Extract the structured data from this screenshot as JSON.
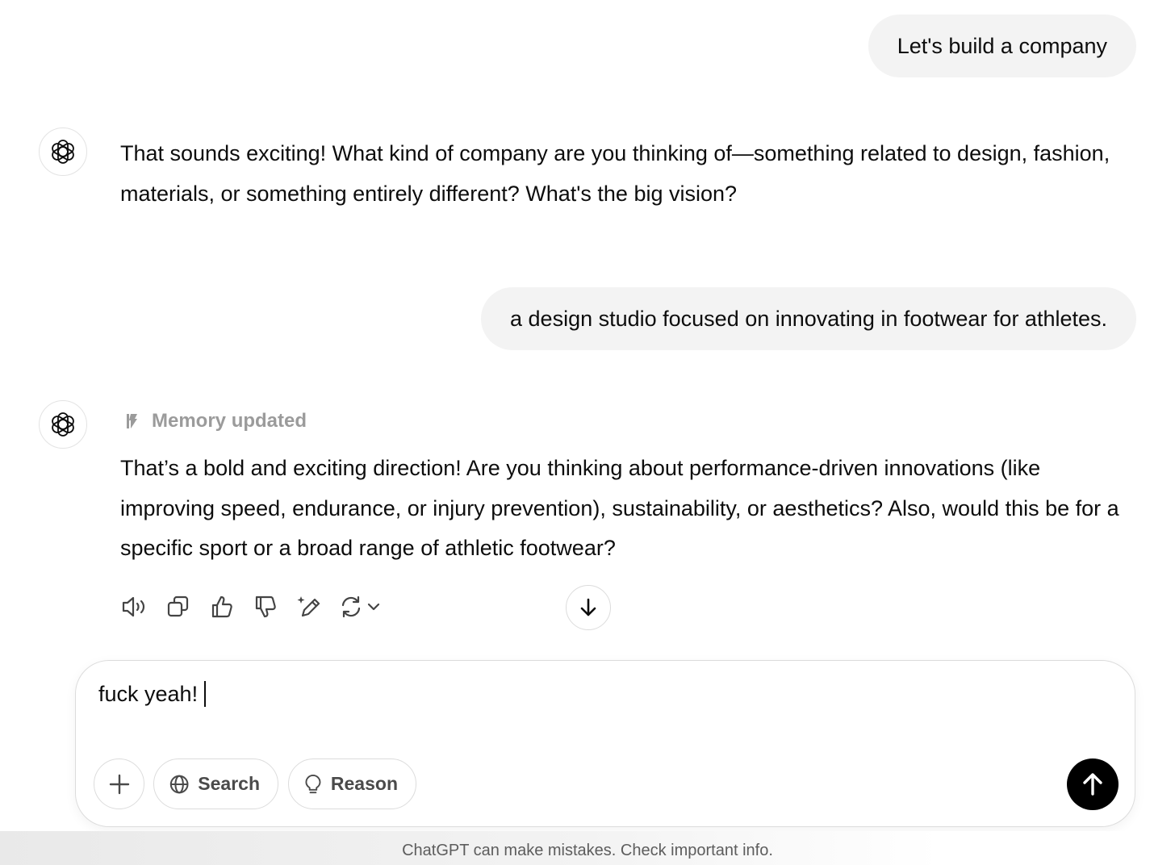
{
  "conversation": {
    "user_messages": [
      "Let's build a company",
      "a design studio focused on innovating in footwear for athletes."
    ],
    "assistant_messages": [
      "That sounds exciting! What kind of company are you thinking of—something related to design, fashion, materials, or something entirely different? What's the big vision?",
      "That’s a bold and exciting direction! Are you thinking about performance-driven innovations (like improving speed, endurance, or injury prevention), sustainability, or aesthetics? Also, would this be for a specific sport or a broad range of athletic footwear?"
    ],
    "memory_status": "Memory updated",
    "avatar_icon": "openai-logo-icon"
  },
  "message_actions": {
    "icons": [
      "speaker-icon",
      "copy-icon",
      "thumbs-up-icon",
      "thumbs-down-icon",
      "edit-sparkle-icon",
      "regenerate-icon",
      "chevron-down-icon"
    ]
  },
  "scroll_button": {
    "icon": "arrow-down-icon"
  },
  "composer": {
    "value": "fuck yeah!",
    "buttons": {
      "plus_icon": "plus-icon",
      "search_label": "Search",
      "search_icon": "globe-icon",
      "reason_label": "Reason",
      "reason_icon": "lightbulb-icon",
      "send_icon": "arrow-up-icon"
    }
  },
  "footer": {
    "disclaimer": "ChatGPT can make mistakes. Check important info."
  },
  "colors": {
    "user_bubble": "#f3f3f3",
    "send_button": "#000000",
    "muted_text": "#9b9b9b"
  }
}
